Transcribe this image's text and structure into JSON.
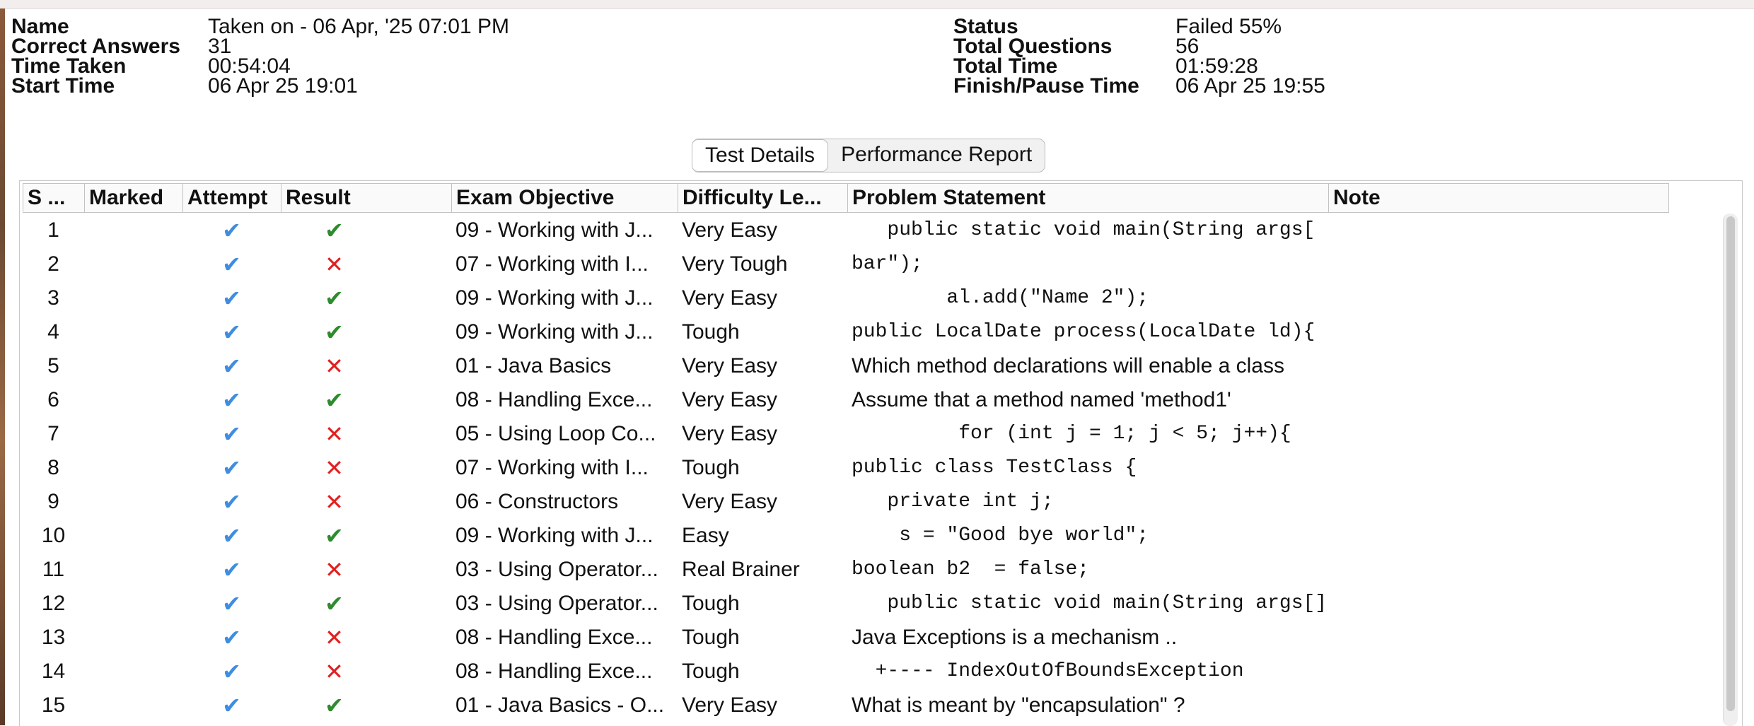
{
  "summary": {
    "left": [
      {
        "label": "Name",
        "value": "Taken on - 06 Apr, '25 07:01 PM"
      },
      {
        "label": "Correct Answers",
        "value": "31"
      },
      {
        "label": "Time Taken",
        "value": "00:54:04"
      },
      {
        "label": "Start Time",
        "value": "06 Apr 25 19:01"
      }
    ],
    "right": [
      {
        "label": "Status",
        "value": "Failed 55%"
      },
      {
        "label": "Total Questions",
        "value": "56"
      },
      {
        "label": "Total Time",
        "value": "01:59:28"
      },
      {
        "label": "Finish/Pause Time",
        "value": "06 Apr 25 19:55"
      }
    ]
  },
  "tabs": [
    {
      "label": "Test Details",
      "active": true
    },
    {
      "label": "Performance Report",
      "active": false
    }
  ],
  "table": {
    "headers": [
      "S ...",
      "Marked",
      "Attempt",
      "Result",
      "Exam Objective",
      "Difficulty Le...",
      "Problem Statement",
      "Note"
    ],
    "rows": [
      {
        "sno": "1",
        "attempt": "✔",
        "result": "correct",
        "objective": "09 - Working with J...",
        "difficulty": "Very Easy",
        "problem": "   public static void main(String args[ ]",
        "mono": true
      },
      {
        "sno": "2",
        "attempt": "✔",
        "result": "wrong",
        "objective": "07 - Working with I...",
        "difficulty": "Very Tough",
        "problem": "bar\");",
        "mono": true
      },
      {
        "sno": "3",
        "attempt": "✔",
        "result": "correct",
        "objective": "09 - Working with J...",
        "difficulty": "Very Easy",
        "problem": "        al.add(\"Name 2\");",
        "mono": true
      },
      {
        "sno": "4",
        "attempt": "✔",
        "result": "correct",
        "objective": "09 - Working with J...",
        "difficulty": "Tough",
        "problem": "public LocalDate process(LocalDate ld){",
        "mono": true
      },
      {
        "sno": "5",
        "attempt": "✔",
        "result": "wrong",
        "objective": "01 - Java Basics",
        "difficulty": "Very Easy",
        "problem": "Which method declarations will enable a class",
        "mono": false
      },
      {
        "sno": "6",
        "attempt": "✔",
        "result": "correct",
        "objective": "08 - Handling Exce...",
        "difficulty": "Very Easy",
        "problem": "Assume that a method named 'method1'",
        "mono": false
      },
      {
        "sno": "7",
        "attempt": "✔",
        "result": "wrong",
        "objective": "05 - Using Loop Co...",
        "difficulty": "Very Easy",
        "problem": "         for (int j = 1; j < 5; j++){",
        "mono": true
      },
      {
        "sno": "8",
        "attempt": "✔",
        "result": "wrong",
        "objective": "07 - Working with I...",
        "difficulty": "Tough",
        "problem": "public class TestClass {",
        "mono": true
      },
      {
        "sno": "9",
        "attempt": "✔",
        "result": "wrong",
        "objective": "06 - Constructors",
        "difficulty": "Very Easy",
        "problem": "   private int j;",
        "mono": true
      },
      {
        "sno": "10",
        "attempt": "✔",
        "result": "correct",
        "objective": "09 - Working with J...",
        "difficulty": "Easy",
        "problem": "    s = \"Good bye world\";",
        "mono": true
      },
      {
        "sno": "11",
        "attempt": "✔",
        "result": "wrong",
        "objective": "03 - Using Operator...",
        "difficulty": "Real Brainer",
        "problem": "boolean b2  = false;",
        "mono": true
      },
      {
        "sno": "12",
        "attempt": "✔",
        "result": "correct",
        "objective": "03 - Using Operator...",
        "difficulty": "Tough",
        "problem": "   public static void main(String args[]){",
        "mono": true
      },
      {
        "sno": "13",
        "attempt": "✔",
        "result": "wrong",
        "objective": "08 - Handling Exce...",
        "difficulty": "Tough",
        "problem": "Java Exceptions is a mechanism ..",
        "mono": false
      },
      {
        "sno": "14",
        "attempt": "✔",
        "result": "wrong",
        "objective": "08 - Handling Exce...",
        "difficulty": "Tough",
        "problem": "  +---- IndexOutOfBoundsException",
        "mono": true
      },
      {
        "sno": "15",
        "attempt": "✔",
        "result": "correct",
        "objective": "01 - Java Basics - O...",
        "difficulty": "Very Easy",
        "problem": "What is meant by \"encapsulation\" ?",
        "mono": false
      }
    ]
  },
  "icons": {
    "attempt": "check-icon",
    "correct": "green-check-icon",
    "wrong": "red-cross-icon"
  },
  "colors": {
    "attempt": "#3f8de0",
    "correct": "#2e8b2e",
    "wrong": "#e02020"
  }
}
